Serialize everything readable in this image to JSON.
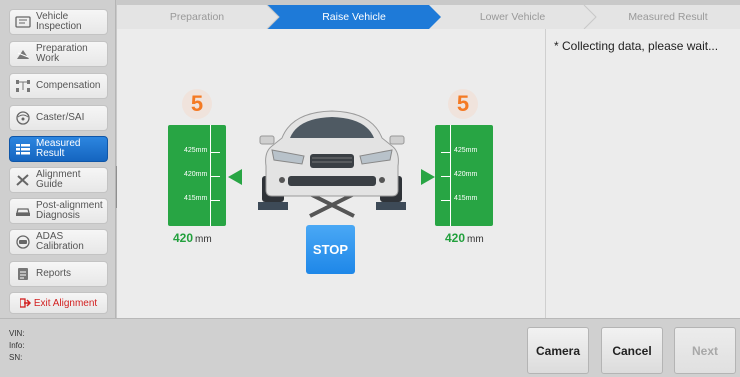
{
  "sidebar": {
    "items": [
      {
        "label": "Vehicle\nInspection",
        "icon": "vehicle-inspection-icon"
      },
      {
        "label": "Preparation\nWork",
        "icon": "preparation-icon"
      },
      {
        "label": "Compensation",
        "icon": "compensation-icon"
      },
      {
        "label": "Caster/SAI",
        "icon": "caster-icon"
      },
      {
        "label": "Measured\nResult",
        "icon": "measured-result-icon",
        "active": true
      },
      {
        "label": "Alignment\nGuide",
        "icon": "alignment-guide-icon"
      },
      {
        "label": "Post-alignment\nDiagnosis",
        "icon": "car-diagnosis-icon"
      },
      {
        "label": "ADAS\nCalibration",
        "icon": "adas-icon"
      },
      {
        "label": "Reports",
        "icon": "reports-icon"
      }
    ],
    "exit_label": "Exit Alignment"
  },
  "steps": [
    "Preparation",
    "Raise Vehicle",
    "Lower Vehicle",
    "Measured Result"
  ],
  "active_step": 1,
  "message": "* Collecting data, please wait...",
  "left": {
    "countdown": "5",
    "ticks": [
      "425mm",
      "420mm",
      "415mm"
    ],
    "height": "420",
    "unit": "mm"
  },
  "right": {
    "countdown": "5",
    "ticks": [
      "425mm",
      "420mm",
      "415mm"
    ],
    "height": "420",
    "unit": "mm"
  },
  "stop_label": "STOP",
  "bottom": {
    "vin_label": "VIN:",
    "info_label": "Info:",
    "sn_label": "SN:",
    "buttons": {
      "camera": "Camera",
      "cancel": "Cancel",
      "next": "Next"
    }
  },
  "colors": {
    "accent": "#1e7ad8",
    "gauge": "#28a544",
    "countdown": "#f47a24",
    "exit": "#d21f1f"
  }
}
